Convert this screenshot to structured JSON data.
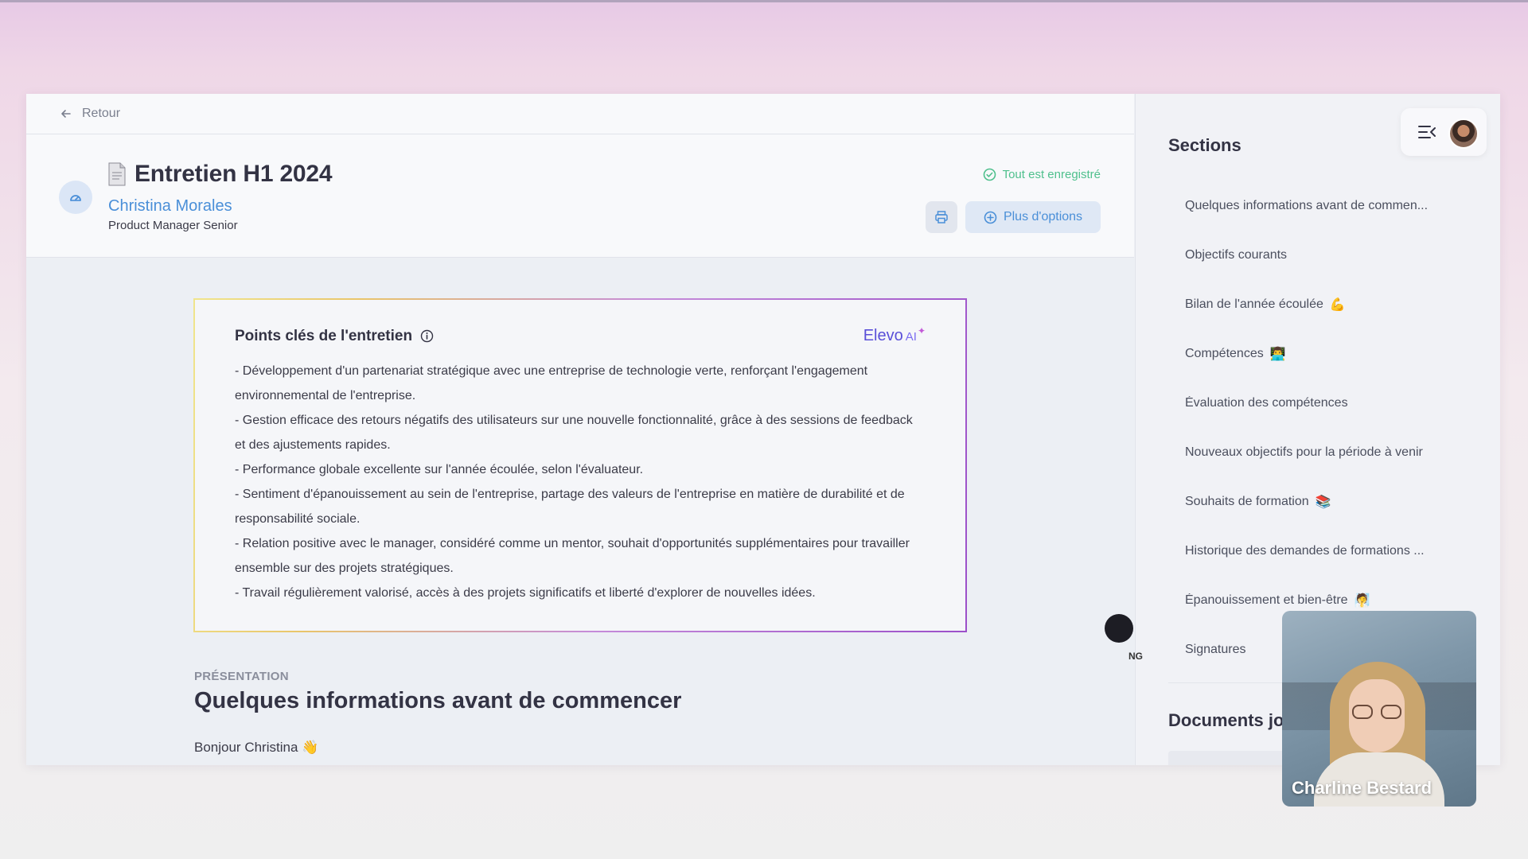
{
  "back": {
    "label": "Retour"
  },
  "header": {
    "title": "Entretien H1 2024",
    "person_name": "Christina Morales",
    "person_role": "Product Manager Senior",
    "saved_status": "Tout est enregistré",
    "options_label": "Plus d'options"
  },
  "ai_card": {
    "title": "Points clés de l'entretien",
    "brand": "Elevo",
    "brand_suffix": "AI",
    "points": [
      "- Développement d'un partenariat stratégique avec une entreprise de technologie verte, renforçant l'engagement environnemental de l'entreprise.",
      "- Gestion efficace des retours négatifs des utilisateurs sur une nouvelle fonctionnalité, grâce à des sessions de feedback et des ajustements rapides.",
      "- Performance globale excellente sur l'année écoulée, selon l'évaluateur.",
      "- Sentiment d'épanouissement au sein de l'entreprise, partage des valeurs de l'entreprise en matière de durabilité et de responsabilité sociale.",
      "- Relation positive avec le manager, considéré comme un mentor, souhait d'opportunités supplémentaires pour travailler ensemble sur des projets stratégiques.",
      "- Travail régulièrement valorisé, accès à des projets significatifs et liberté d'explorer de nouvelles idées."
    ]
  },
  "content": {
    "kicker": "PRÉSENTATION",
    "section_title": "Quelques informations avant de commencer",
    "greeting": "Bonjour Christina 👋"
  },
  "sidebar": {
    "title": "Sections",
    "items": [
      {
        "label": "Quelques informations avant de commen...",
        "emoji": ""
      },
      {
        "label": "Objectifs courants",
        "emoji": ""
      },
      {
        "label": "Bilan de l'année écoulée",
        "emoji": "💪"
      },
      {
        "label": "Compétences",
        "emoji": "👨‍💻"
      },
      {
        "label": "Évaluation des compétences",
        "emoji": ""
      },
      {
        "label": "Nouveaux objectifs pour la période à venir",
        "emoji": ""
      },
      {
        "label": "Souhaits de formation",
        "emoji": "📚"
      },
      {
        "label": "Historique des demandes de formations ...",
        "emoji": ""
      },
      {
        "label": "Épanouissement et bien-être",
        "emoji": "🧖"
      },
      {
        "label": "Signatures",
        "emoji": ""
      }
    ],
    "docs_title": "Documents jo",
    "ng_text": "NG"
  },
  "video": {
    "participant": "Charline Bestard"
  },
  "colors": {
    "accent_blue": "#4a8fd8",
    "saved_green": "#4fc08d",
    "ai_purple": "#9b4fc9",
    "ai_yellow": "#f0e58c"
  }
}
